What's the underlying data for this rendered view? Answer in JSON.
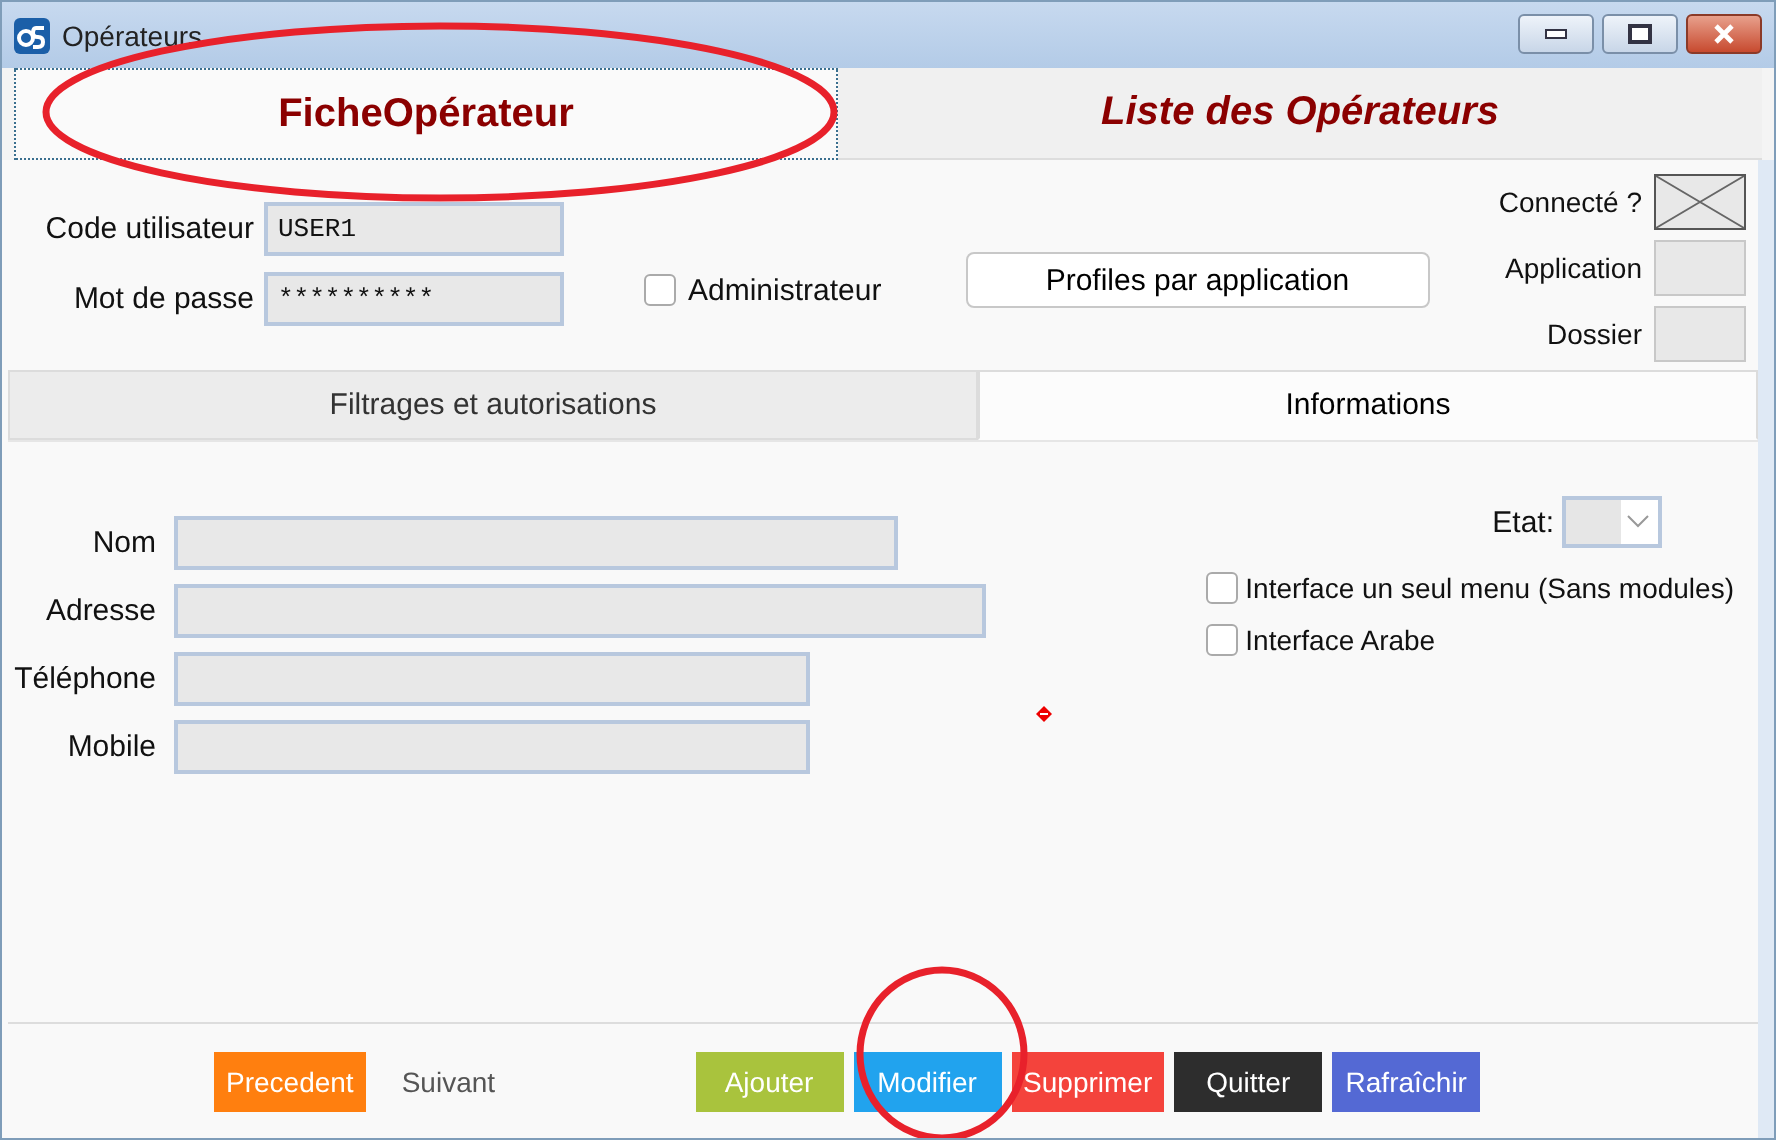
{
  "window": {
    "title": "Opérateurs"
  },
  "main_tabs": [
    {
      "label": "FicheOpérateur",
      "selected": true
    },
    {
      "label": "Liste des Opérateurs",
      "selected": false
    }
  ],
  "fields": [
    {
      "label": "Code utilisateur",
      "value": "USER1"
    },
    {
      "label": "Mot de passe",
      "value": "**********"
    }
  ],
  "administrateur": {
    "label": "Administrateur",
    "checked": false
  },
  "profiles_button": "Profiles par application",
  "status": [
    {
      "label": "Connecté ?",
      "kind": "cross"
    },
    {
      "label": "Application",
      "kind": "empty"
    },
    {
      "label": "Dossier",
      "kind": "empty"
    }
  ],
  "sub_tabs": [
    {
      "label": "Filtrages et autorisations",
      "selected": false
    },
    {
      "label": "Informations",
      "selected": true
    }
  ],
  "info_fields": [
    {
      "label": "Nom"
    },
    {
      "label": "Adresse"
    },
    {
      "label": "Téléphone"
    },
    {
      "label": "Mobile"
    }
  ],
  "etat": {
    "label": "Etat:"
  },
  "options": [
    {
      "label": "Interface un seul menu (Sans modules)",
      "checked": false
    },
    {
      "label": "Interface Arabe",
      "checked": false
    }
  ],
  "nav": [
    {
      "label": "Precedent",
      "kind": "filled",
      "color": "#ff7f0f"
    },
    {
      "label": "Suivant",
      "kind": "plain",
      "color": "#f9f9f9"
    }
  ],
  "actions": [
    {
      "label": "Ajouter",
      "color": "#a9c33d"
    },
    {
      "label": "Modifier",
      "color": "#21a3ee"
    },
    {
      "label": "Supprimer",
      "color": "#f4433c"
    },
    {
      "label": "Quitter",
      "color": "#2d2d2d"
    },
    {
      "label": "Rafraîchir",
      "color": "#5469d4"
    }
  ],
  "annotations": [
    {
      "kind": "ellipse"
    },
    {
      "kind": "circle"
    }
  ]
}
